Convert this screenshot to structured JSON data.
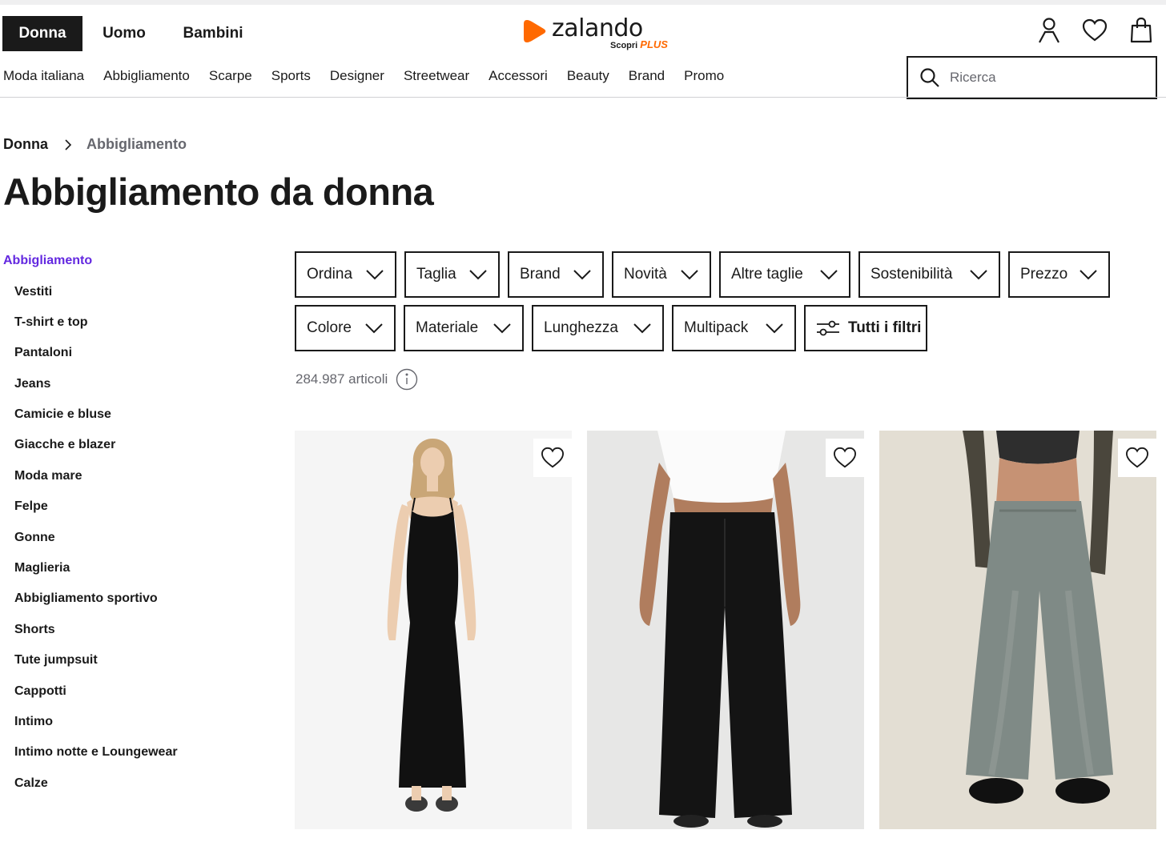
{
  "header": {
    "gender_tabs": [
      "Donna",
      "Uomo",
      "Bambini"
    ],
    "logo_text": "zalando",
    "logo_scopri": "Scopri",
    "logo_plus": "PLUS",
    "search_placeholder": "Ricerca",
    "category_nav": [
      "Moda italiana",
      "Abbigliamento",
      "Scarpe",
      "Sports",
      "Designer",
      "Streetwear",
      "Accessori",
      "Beauty",
      "Brand",
      "Promo"
    ],
    "icons": [
      "user-icon",
      "heart-icon",
      "bag-icon"
    ]
  },
  "breadcrumb": {
    "root": "Donna",
    "current": "Abbigliamento"
  },
  "page_title": "Abbigliamento da donna",
  "sidebar": {
    "heading": "Abbigliamento",
    "heading_color": "#6328e0",
    "items": [
      "Vestiti",
      "T-shirt e top",
      "Pantaloni",
      "Jeans",
      "Camicie e bluse",
      "Giacche e blazer",
      "Moda mare",
      "Felpe",
      "Gonne",
      "Maglieria",
      "Abbigliamento sportivo",
      "Shorts",
      "Tute jumpsuit",
      "Cappotti",
      "Intimo",
      "Intimo notte e Loungewear",
      "Calze"
    ]
  },
  "filters": {
    "row1": [
      "Ordina",
      "Taglia",
      "Brand",
      "Novità",
      "Altre taglie",
      "Sostenibilità",
      "Prezzo"
    ],
    "row2": [
      "Colore",
      "Materiale",
      "Lunghezza",
      "Multipack"
    ],
    "all_filters": "Tutti i filtri"
  },
  "results": {
    "count": "284.987 articoli"
  },
  "products": [
    {
      "name": "product-black-slip-dress",
      "bg": "#f5f5f5"
    },
    {
      "name": "product-black-trousers",
      "bg": "#e7e7e6"
    },
    {
      "name": "product-wide-leg-jeans",
      "bg": "#e3ded3"
    }
  ],
  "colors": {
    "brand_orange": "#ff6900",
    "accent_purple": "#6328e0",
    "text": "#1a1a1a",
    "muted": "#66676e"
  }
}
